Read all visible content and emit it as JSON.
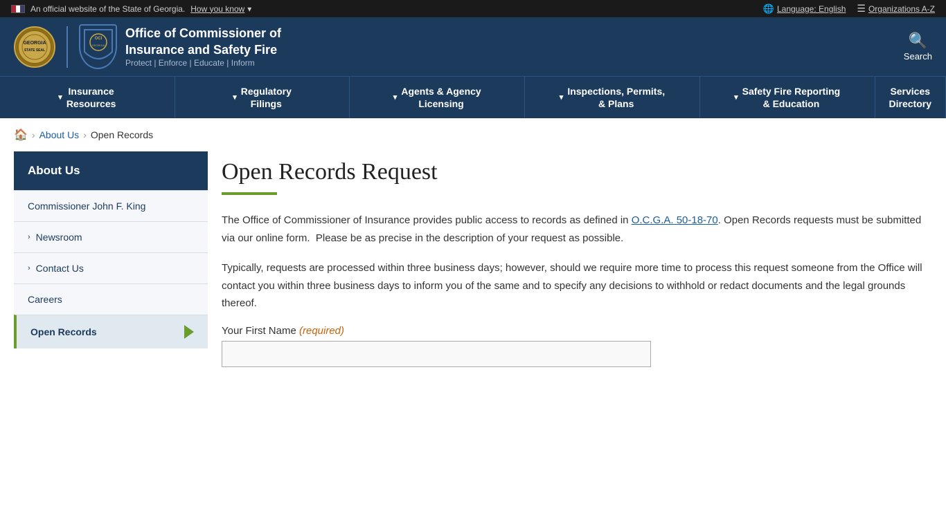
{
  "topbar": {
    "official_text": "An official website of the State of Georgia.",
    "how_you_know": "How you know",
    "language_label": "Language: English",
    "orgs_label": "Organizations A-Z"
  },
  "header": {
    "org_name_line1": "Office of Commissioner of",
    "org_name_line2": "Insurance and Safety Fire",
    "tagline": "Protect | Enforce | Educate | Inform",
    "search_label": "Search"
  },
  "nav": {
    "items": [
      {
        "label": "Insurance Resources",
        "has_chevron": true
      },
      {
        "label": "Regulatory Filings",
        "has_chevron": true
      },
      {
        "label": "Agents & Agency Licensing",
        "has_chevron": true
      },
      {
        "label": "Inspections, Permits, & Plans",
        "has_chevron": true
      },
      {
        "label": "Safety Fire Reporting & Education",
        "has_chevron": true
      },
      {
        "label": "Services Directory",
        "has_chevron": false
      }
    ]
  },
  "breadcrumb": {
    "home_label": "Home",
    "about_us": "About Us",
    "current": "Open Records"
  },
  "sidebar": {
    "heading": "About Us",
    "items": [
      {
        "label": "Commissioner John F. King",
        "has_chevron": false,
        "active": false
      },
      {
        "label": "Newsroom",
        "has_chevron": true,
        "active": false
      },
      {
        "label": "Contact Us",
        "has_chevron": true,
        "active": false
      },
      {
        "label": "Careers",
        "has_chevron": false,
        "active": false
      },
      {
        "label": "Open Records",
        "has_chevron": false,
        "active": true
      }
    ]
  },
  "main": {
    "page_title": "Open Records Request",
    "intro_paragraph": "The Office of Commissioner of Insurance provides public access to records as defined in O.C.G.A. 50-18-70. Open Records requests must be submitted via our online form.  Please be as precise in the description of your request as possible.",
    "link_text": "O.C.G.A. 50-18-70",
    "second_paragraph": "Typically, requests are processed within three business days; however, should we require more time to process this request someone from the Office will contact you within three business days to inform you of the same and to specify any decisions to withhold or redact documents and the legal grounds thereof.",
    "field_label": "Your First Name",
    "required_label": "(required)"
  }
}
